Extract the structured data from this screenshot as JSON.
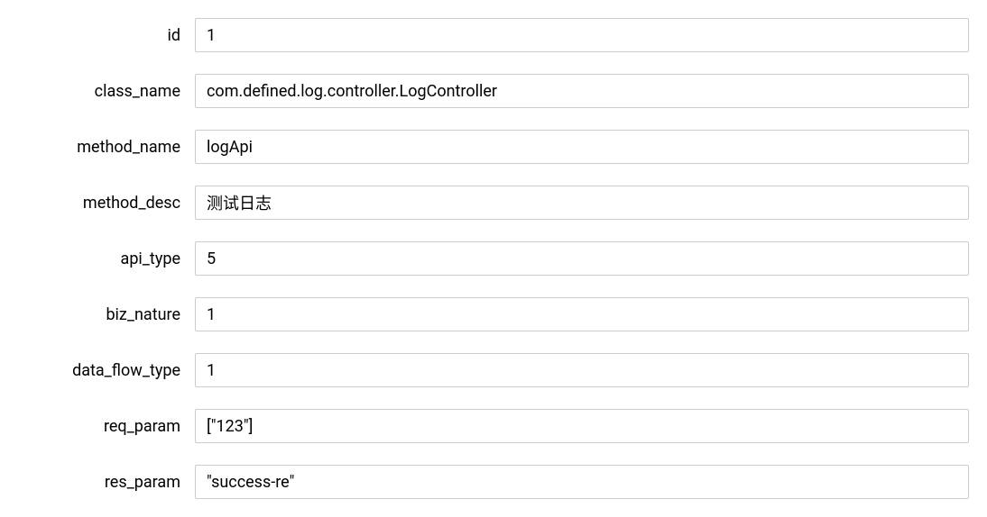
{
  "form": {
    "fields": [
      {
        "label": "id",
        "value": "1"
      },
      {
        "label": "class_name",
        "value": "com.defined.log.controller.LogController"
      },
      {
        "label": "method_name",
        "value": "logApi"
      },
      {
        "label": "method_desc",
        "value": "测试日志"
      },
      {
        "label": "api_type",
        "value": "5"
      },
      {
        "label": "biz_nature",
        "value": "1"
      },
      {
        "label": "data_flow_type",
        "value": "1"
      },
      {
        "label": "req_param",
        "value": "[\"123\"]"
      },
      {
        "label": "res_param",
        "value": "\"success-re\""
      }
    ]
  }
}
